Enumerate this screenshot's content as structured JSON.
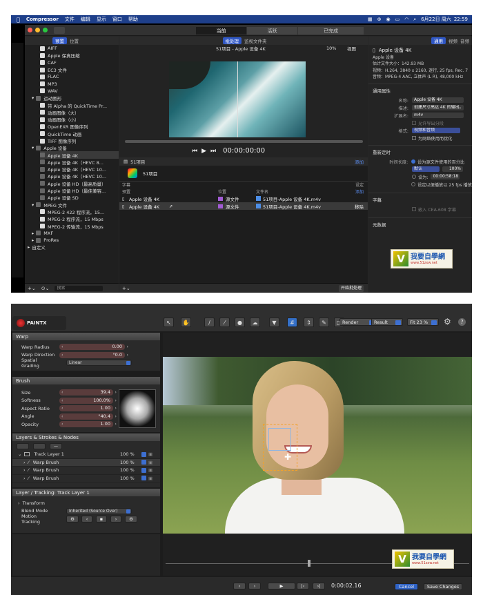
{
  "compressor": {
    "menubar": {
      "app": "Compressor",
      "menus": [
        "文件",
        "编辑",
        "显示",
        "窗口",
        "帮助"
      ],
      "date": "6月22日 周六",
      "time": "22:59"
    },
    "window_tabs": [
      "当前",
      "活跃",
      "已完成"
    ],
    "sidebar": {
      "tabs": [
        "预置",
        "位置"
      ],
      "items": [
        "AIFF",
        "Apple 保真压缩",
        "CAF",
        "EC3 文件",
        "FLAC",
        "MP3",
        "WAV"
      ],
      "motion_group": "运动图形",
      "motion_items": [
        "带 Alpha 的 QuickTime Pr...",
        "动画图像（大）",
        "动画图像（小）",
        "OpenEXR 图像序列",
        "QuickTime 动画",
        "TIFF 图像序列"
      ],
      "apple_group": "Apple 设备",
      "apple_items": [
        "Apple 设备 4K",
        "Apple 设备 4K（HEVC 8...",
        "Apple 设备 4K（HEVC 10...",
        "Apple 设备 4K（HEVC 10...",
        "Apple 设备 HD（最高质量）",
        "Apple 设备 HD（最佳兼容...",
        "Apple 设备 SD"
      ],
      "mpeg_group": "MPEG 文件",
      "mpeg_items": [
        "MPEG-2 422 程序流，15...",
        "MPEG-2 程序流，15 Mbps",
        "MPEG-2 传输流，15 Mbps"
      ],
      "other_groups": [
        "MXF",
        "ProRes"
      ],
      "custom": "自定义",
      "search_placeholder": "搜索"
    },
    "center": {
      "tabs": [
        "批处理",
        "监视文件夹"
      ],
      "preview_title": "51项目 - Apple 设备 4K",
      "zoom": "10%",
      "view": "视图",
      "timecode": "00:00:00:00",
      "batch_title": "51项目",
      "add": "添加",
      "job_name": "51项目",
      "subtitle_col": "字幕",
      "setting_label": "设定",
      "cols": [
        "预置",
        "位置",
        "文件名"
      ],
      "rows": [
        {
          "preset": "Apple 设备 4K",
          "location": "源文件",
          "file": "51项目-Apple 设备 4K.m4v"
        },
        {
          "preset": "Apple 设备 4K",
          "location": "源文件",
          "file": "51项目-Apple 设备 4K.m4v"
        }
      ],
      "remove": "移除",
      "start": "开始批处理"
    },
    "inspector": {
      "tabs": [
        "通用",
        "视频",
        "音频"
      ],
      "title": "Apple 设备 4K",
      "subtitle": "Apple 设备",
      "size": "估计文件大小：142.93 MB",
      "video": "视频：H.264, 3840 x 2160, 逐行, 25 fps, Rec. 7",
      "audio": "音频：MPEG-4 AAC, 立体声 (L R), 48,000 kHz",
      "section_general": "通用属性",
      "name_k": "名称:",
      "name_v": "Apple 设备 4K",
      "desc_k": "描述:",
      "desc_v": "创建尺寸高达 4K 的输出。",
      "ext_k": "扩展名:",
      "ext_v": "m4v",
      "allow_split": "允许导出分段",
      "format_k": "格式:",
      "format_v": "视频和音频",
      "optimize": "为网络使用而优化",
      "section_retime": "重新定时",
      "duration_k": "时间长度:",
      "duration_opt": "设为源文件使用的百分比",
      "default": "默认",
      "percent": "100%",
      "set_to": "设为:",
      "set_to_val": "00:00:58:18",
      "fps_opt": "设定以便播放以 25 fps 播放",
      "section_subs": "字幕",
      "cea": "嵌入 CEA-608 字幕",
      "section_meta": "元数据"
    }
  },
  "watermark": {
    "title": "我要自學網",
    "url": "www.51zxw.net"
  },
  "paintx": {
    "logo": "PAINTX",
    "render_dd": "Render",
    "result_dd": "Result",
    "fit_dd": "Fit 23 %",
    "warp": {
      "title": "Warp",
      "radius_label": "Warp Radius",
      "radius_val": "0.00",
      "direction_label": "Warp Direction",
      "direction_val": "°0.0",
      "grading_label": "Spatial Grading",
      "grading_val": "Linear"
    },
    "brush": {
      "title": "Brush",
      "size_label": "Size",
      "size_val": "39.4",
      "softness_label": "Softness",
      "softness_val": "100.0%",
      "aspect_label": "Aspect Ratio",
      "aspect_val": "1.00",
      "angle_label": "Angle",
      "angle_val": "°40.4",
      "opacity_label": "Opacity",
      "opacity_val": "1.00"
    },
    "layers": {
      "title": "Layers & Strokes & Nodes",
      "track": "Track Layer 1",
      "track_val": "100 %",
      "brushes": [
        {
          "name": "Warp Brush",
          "val": "100 %"
        },
        {
          "name": "Warp Brush",
          "val": "100 %"
        },
        {
          "name": "Warp Brush",
          "val": "100 %"
        }
      ]
    },
    "tracking": {
      "title": "Layer / Tracking: Track Layer 1",
      "transform": "Transform",
      "blend_label": "Blend Mode",
      "blend_val": "Inherited (Source Over)",
      "motion_label": "Motion Tracking"
    },
    "timecode": "0:00:02.16",
    "cancel": "Cancel",
    "save": "Save Changes"
  }
}
